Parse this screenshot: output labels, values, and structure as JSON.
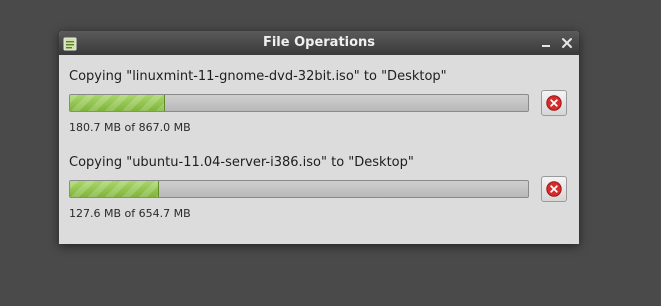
{
  "window": {
    "title": "File Operations",
    "minimize_icon": "minimize-icon",
    "close_icon": "close-icon",
    "app_icon": "file-operations-icon"
  },
  "operations": [
    {
      "label": "Copying \"linuxmint-11-gnome-dvd-32bit.iso\" to \"Desktop\"",
      "progress_fraction": 0.208,
      "size_text": "180.7 MB of 867.0 MB",
      "cancel_icon": "cancel-icon"
    },
    {
      "label": "Copying \"ubuntu-11.04-server-i386.iso\" to \"Desktop\"",
      "progress_fraction": 0.195,
      "size_text": "127.6 MB of 654.7 MB",
      "cancel_icon": "cancel-icon"
    }
  ],
  "colors": {
    "progress_green": "#8cc14a",
    "cancel_red": "#d62c2c",
    "titlebar": "#4a4a4a"
  }
}
